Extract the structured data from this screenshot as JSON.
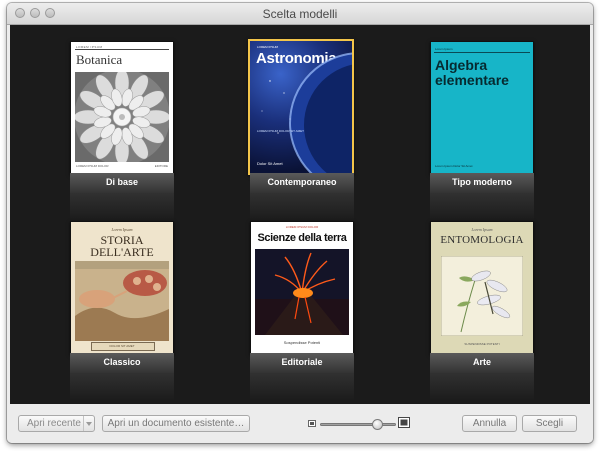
{
  "window": {
    "title": "Scelta modelli"
  },
  "templates": [
    {
      "label": "Di base",
      "cover": {
        "header": "LOREM IPSUM",
        "title": "Botanica",
        "footer": "LOREM IPSUM DOLOR",
        "imprint": "EDITORE"
      }
    },
    {
      "label": "Contemporaneo",
      "cover": {
        "header": "LOREM IPSUM",
        "title": "Astronomia",
        "subheader": "LOREM IPSUM DOLOR SIT AMET",
        "author": "Dolor Sit Amet"
      }
    },
    {
      "label": "Tipo moderno",
      "cover": {
        "header": "Lorem Ipsum",
        "title_line1": "Algebra",
        "title_line2": "elementare",
        "footer": "Lorem Ipsum Dolor Sit Amet"
      }
    },
    {
      "label": "Classico",
      "cover": {
        "header": "Lorem Ipsum",
        "title_line1": "STORIA",
        "title_line2": "DELL'ARTE",
        "footer": "DOLOR SIT AMET"
      }
    },
    {
      "label": "Editoriale",
      "cover": {
        "header": "LOREM IPSUM DOLOR",
        "title": "Scienze della terra",
        "footer": "Sospendisse Potenti"
      }
    },
    {
      "label": "Arte",
      "cover": {
        "header": "Lorem Ipsum",
        "title": "ENTOMOLOGIA",
        "footer": "SUSPENDISSE POTENTI"
      }
    }
  ],
  "footer": {
    "recent_label": "Apri recente",
    "open_existing_label": "Apri un documento esistente…",
    "zoom_level": 0.8,
    "cancel_label": "Annulla",
    "choose_label": "Scegli"
  },
  "colors": {
    "selection": "#f3c54a",
    "gallery_bg": "#1b1b1b"
  }
}
